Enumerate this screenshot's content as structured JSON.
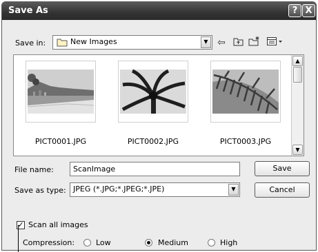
{
  "window": {
    "title": "Save As",
    "help_label": "?",
    "close_label": "X"
  },
  "save_in": {
    "label": "Save in:",
    "value": "New Images",
    "folder_icon": "folder-icon",
    "toolbar_icons": [
      "back-arrow-icon",
      "up-folder-icon",
      "new-folder-icon",
      "view-menu-icon"
    ]
  },
  "files": [
    {
      "name": "PICT0001.JPG",
      "thumb": "beach-city-photo"
    },
    {
      "name": "PICT0002.JPG",
      "thumb": "palm-tree-photo"
    },
    {
      "name": "PICT0003.JPG",
      "thumb": "palm-fronds-photo"
    }
  ],
  "form": {
    "file_name_label": "File name:",
    "file_name_value": "ScanImage",
    "type_label": "Save as type:",
    "type_value": "JPEG (*.JPG;*.JPEG;*.JPE)"
  },
  "buttons": {
    "save": "Save",
    "cancel": "Cancel"
  },
  "scan_all": {
    "label": "Scan all images",
    "checked": true
  },
  "compression": {
    "label": "Compression:",
    "options": [
      "Low",
      "Medium",
      "High"
    ],
    "selected": "Medium"
  }
}
